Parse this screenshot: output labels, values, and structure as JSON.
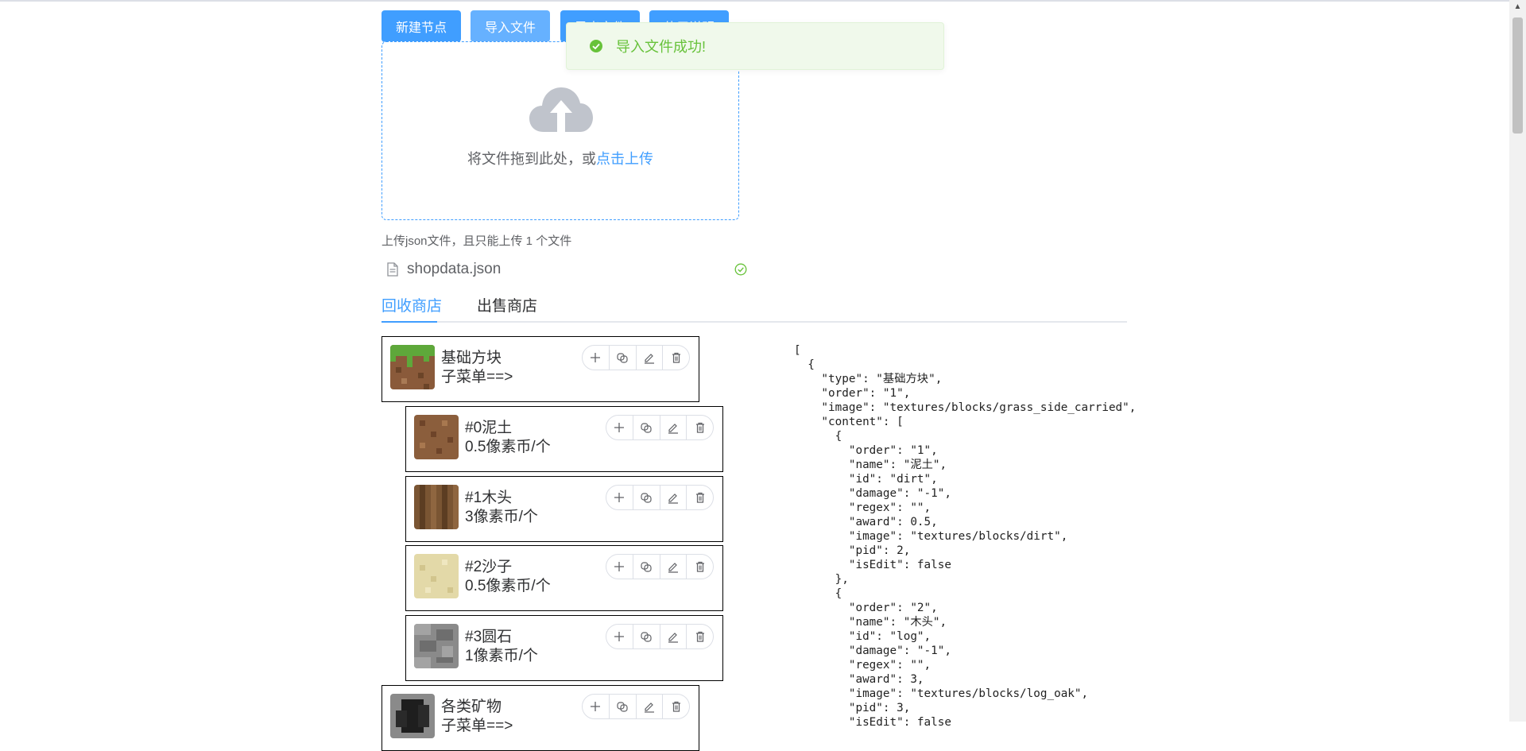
{
  "toolbar": {
    "new_node": "新建节点",
    "import_file": "导入文件",
    "export_file": "导出文件",
    "other_setting": "使用说明"
  },
  "toast": {
    "message": "导入文件成功!"
  },
  "upload": {
    "drag_text": "将文件拖到此处，或",
    "click_text": "点击上传",
    "tip": "上传json文件，且只能上传 1 个文件",
    "file_name": "shopdata.json"
  },
  "tabs": [
    {
      "label": "回收商店"
    },
    {
      "label": "出售商店"
    }
  ],
  "nodes": [
    {
      "title": "基础方块",
      "sub": "子菜单==>",
      "texture": "grass"
    },
    {
      "title": "#0泥土",
      "sub": "0.5像素币/个",
      "texture": "dirt"
    },
    {
      "title": "#1木头",
      "sub": "3像素币/个",
      "texture": "log"
    },
    {
      "title": "#2沙子",
      "sub": "0.5像素币/个",
      "texture": "sand"
    },
    {
      "title": "#3圆石",
      "sub": "1像素币/个",
      "texture": "cobble"
    },
    {
      "title": "各类矿物",
      "sub": "子菜单==>",
      "texture": "coal"
    }
  ],
  "json_text": "[\n  {\n    \"type\": \"基础方块\",\n    \"order\": \"1\",\n    \"image\": \"textures/blocks/grass_side_carried\",\n    \"content\": [\n      {\n        \"order\": \"1\",\n        \"name\": \"泥土\",\n        \"id\": \"dirt\",\n        \"damage\": \"-1\",\n        \"regex\": \"\",\n        \"award\": 0.5,\n        \"image\": \"textures/blocks/dirt\",\n        \"pid\": 2,\n        \"isEdit\": false\n      },\n      {\n        \"order\": \"2\",\n        \"name\": \"木头\",\n        \"id\": \"log\",\n        \"damage\": \"-1\",\n        \"regex\": \"\",\n        \"award\": 3,\n        \"image\": \"textures/blocks/log_oak\",\n        \"pid\": 3,\n        \"isEdit\": false"
}
